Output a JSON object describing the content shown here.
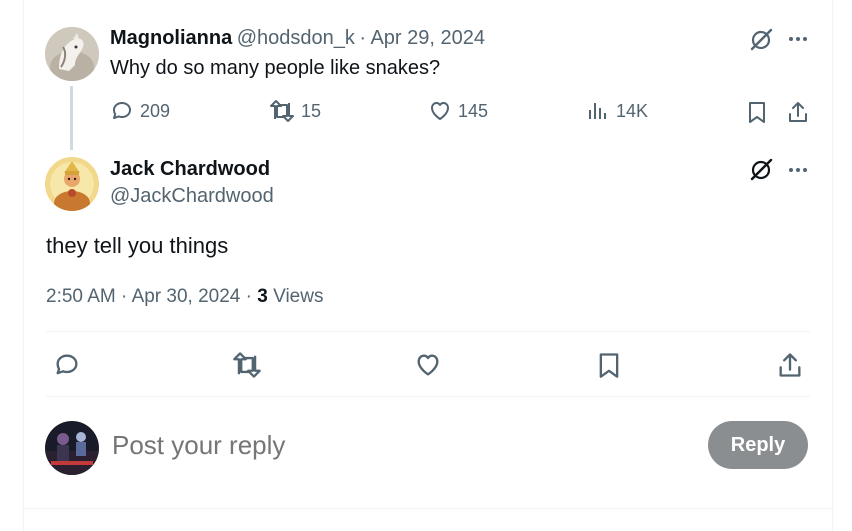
{
  "parent_tweet": {
    "display_name": "Magnolianna",
    "handle": "@hodsdon_k",
    "separator": "·",
    "date": "Apr 29, 2024",
    "text": "Why do so many people like snakes?",
    "reply_count": "209",
    "repost_count": "15",
    "like_count": "145",
    "view_count": "14K"
  },
  "main_tweet": {
    "display_name": "Jack Chardwood",
    "handle": "@JackChardwood",
    "text": "they tell you things",
    "time": "2:50 AM",
    "separator": "·",
    "date": "Apr 30, 2024",
    "separator2": "·",
    "view_count": "3",
    "views_label": "Views"
  },
  "reply_box": {
    "placeholder": "Post your reply",
    "button_label": "Reply"
  },
  "icons": {
    "reply": "reply-icon",
    "repost": "repost-icon",
    "like": "like-icon",
    "views": "views-icon",
    "bookmark": "bookmark-icon",
    "share": "share-icon",
    "grok": "grok-icon",
    "more": "more-icon"
  },
  "colors": {
    "text": "#0f1419",
    "muted": "#536471",
    "reply_button": "#8b8e91",
    "divider": "#eff3f4",
    "thread_line": "#cfd9de"
  }
}
